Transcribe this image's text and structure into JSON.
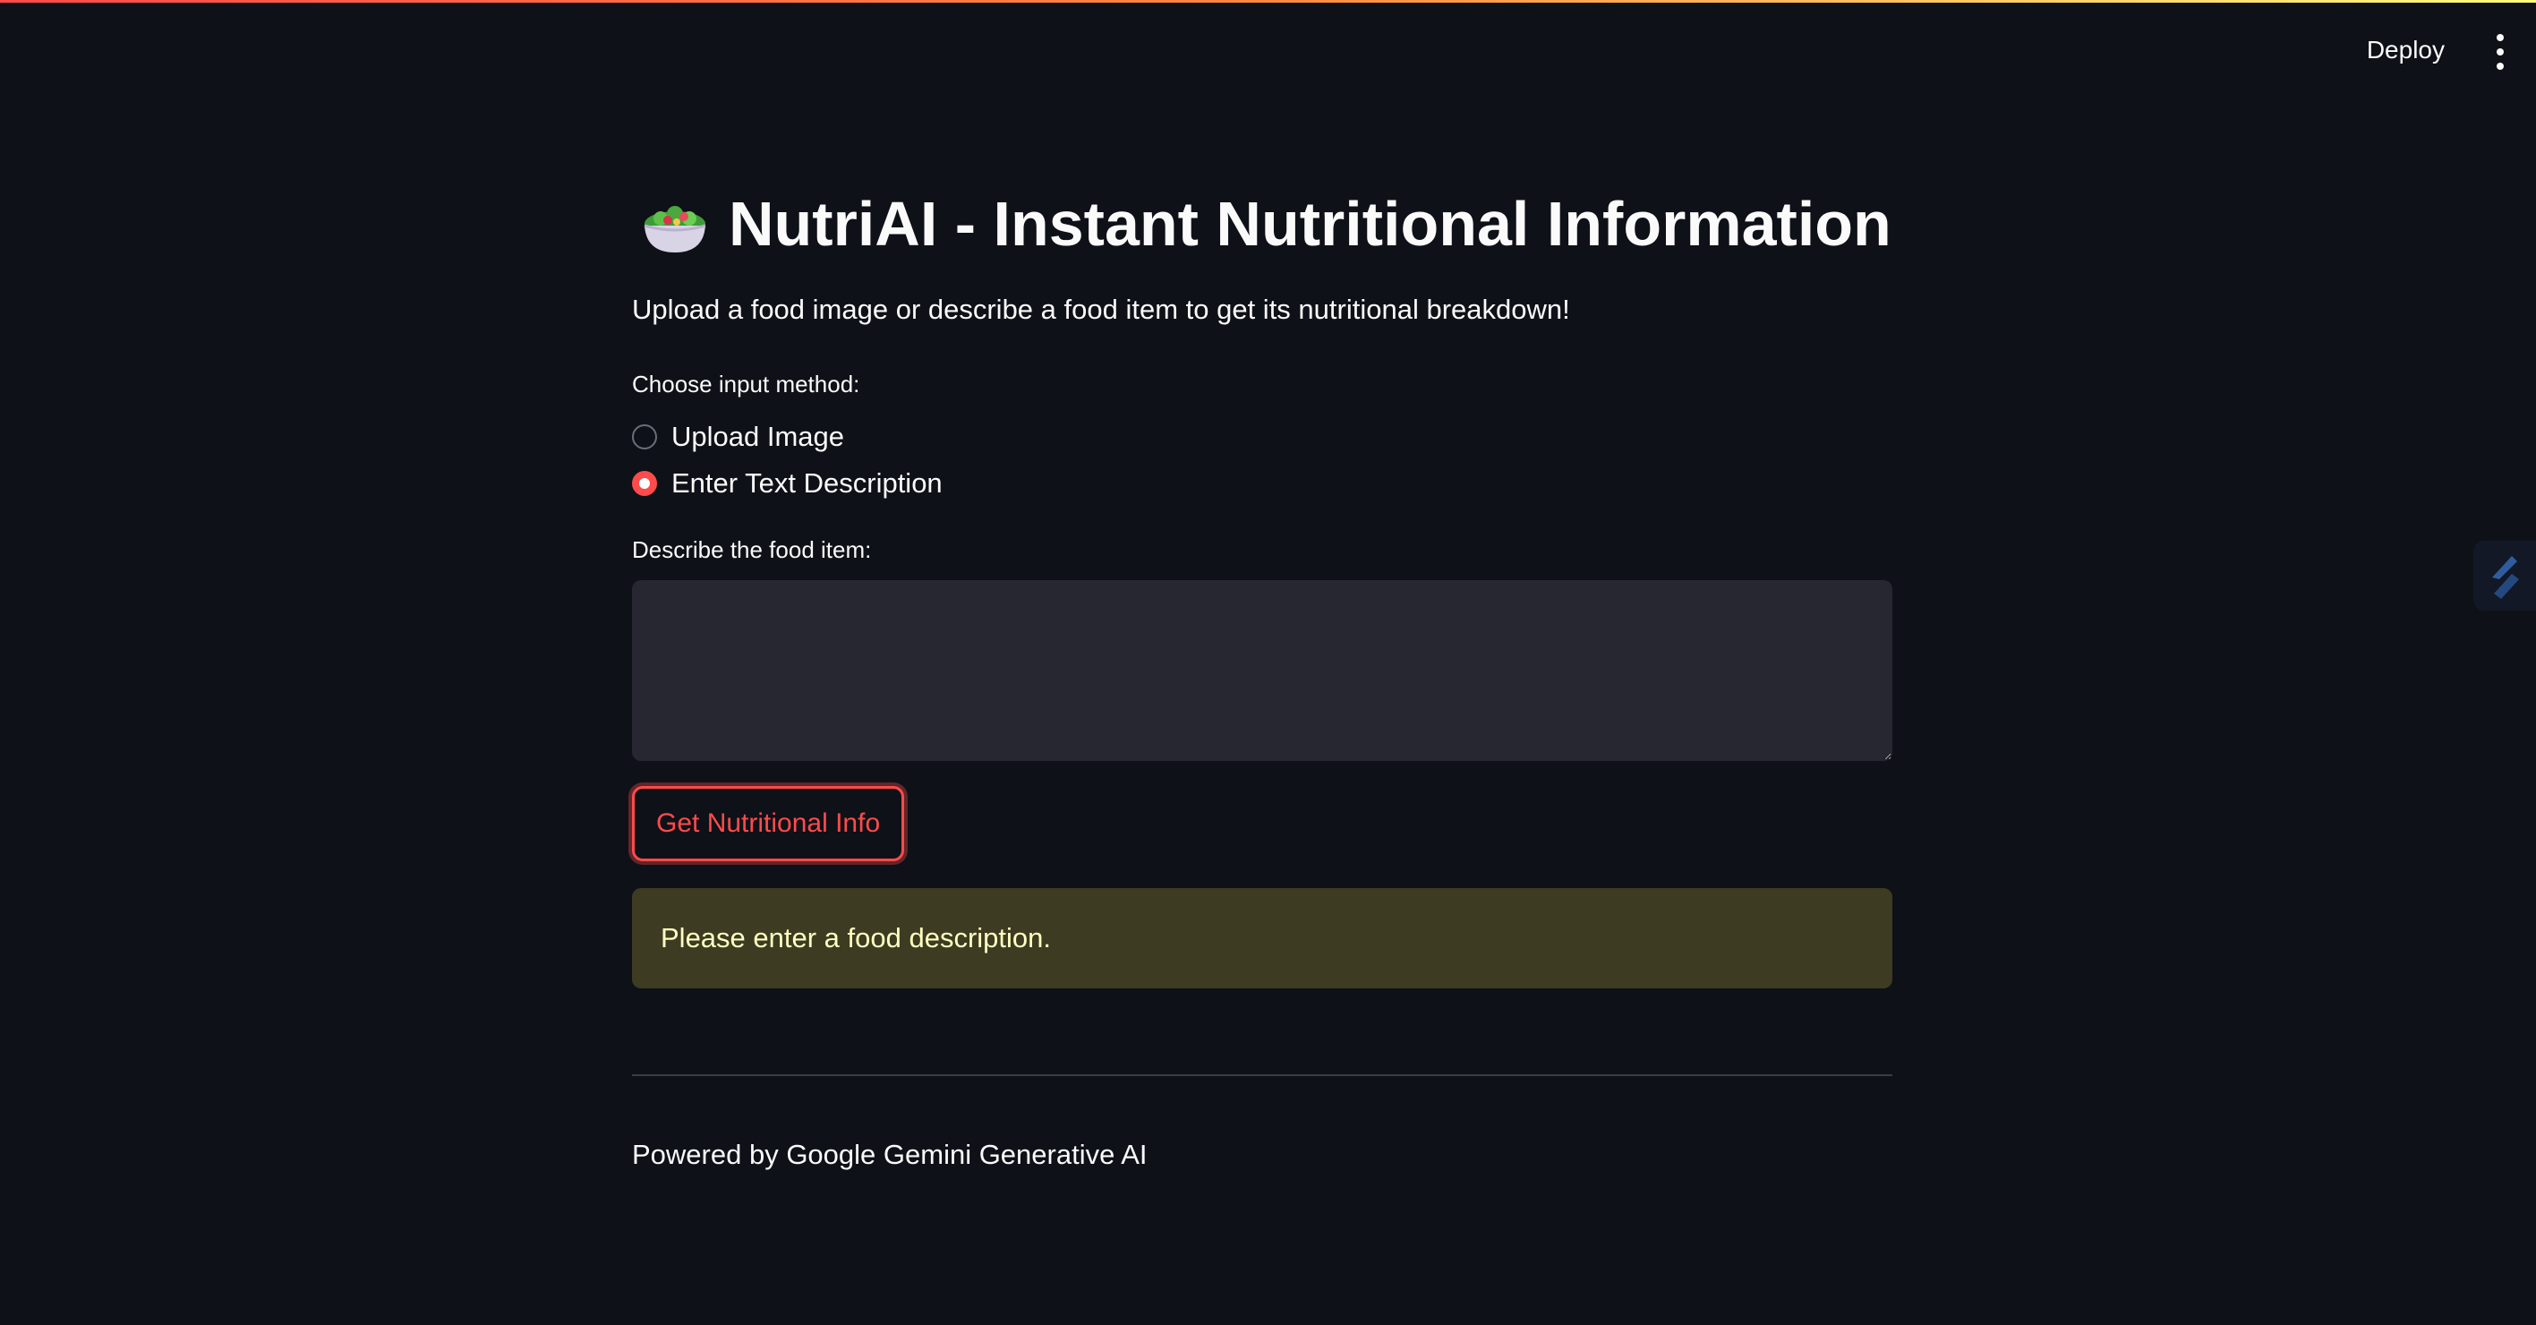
{
  "header": {
    "deploy_label": "Deploy",
    "menu_icon": "vertical-ellipsis-icon"
  },
  "main": {
    "title_icon": "salad-bowl-icon",
    "title": "NutriAI - Instant Nutritional Information",
    "subtitle": "Upload a food image or describe a food item to get its nutritional breakdown!",
    "input_method": {
      "label": "Choose input method:",
      "options": [
        {
          "label": "Upload Image",
          "selected": false
        },
        {
          "label": "Enter Text Description",
          "selected": true
        }
      ]
    },
    "description_field": {
      "label": "Describe the food item:",
      "value": "",
      "placeholder": ""
    },
    "submit_button_label": "Get Nutritional Info",
    "warning_message": "Please enter a food description.",
    "footer_text": "Powered by Google Gemini Generative AI"
  },
  "colors": {
    "background": "#0e1117",
    "accent": "#ff4b4b",
    "warning_bg": "#3d3c22",
    "warning_text": "#ffffc2",
    "input_bg": "#262730"
  }
}
